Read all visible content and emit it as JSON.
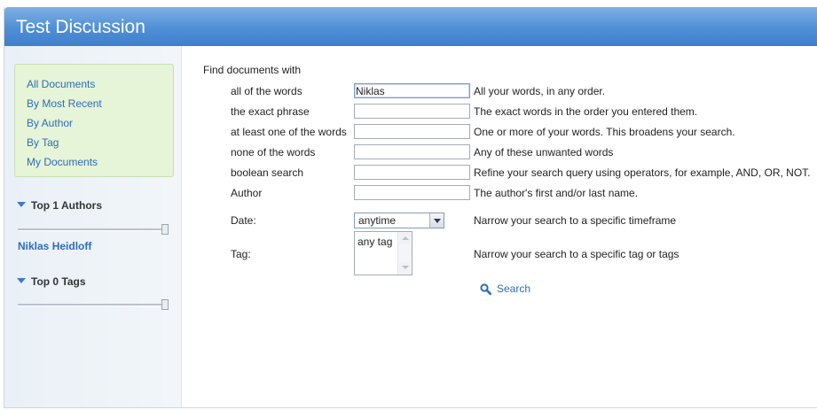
{
  "header": {
    "title": "Test Discussion"
  },
  "sidebar": {
    "nav": [
      "All Documents",
      "By Most Recent",
      "By Author",
      "By Tag",
      "My Documents"
    ],
    "authors_title": "Top 1 Authors",
    "authors": [
      "Niklas Heidloff"
    ],
    "tags_title": "Top 0 Tags"
  },
  "search": {
    "intro": "Find documents with",
    "rows": [
      {
        "label": "all of the words",
        "value": "Niklas",
        "hint": "All your words, in any order."
      },
      {
        "label": "the exact phrase",
        "value": "",
        "hint": "The exact words in the order you entered them."
      },
      {
        "label": "at least one of the words",
        "value": "",
        "hint": "One or more of your words. This broadens your search."
      },
      {
        "label": "none of the words",
        "value": "",
        "hint": "Any of these unwanted words"
      },
      {
        "label": "boolean search",
        "value": "",
        "hint": "Refine your search query using operators, for example, AND, OR, NOT."
      },
      {
        "label": "Author",
        "value": "",
        "hint": "The author's first and/or last name."
      }
    ],
    "date": {
      "label": "Date:",
      "selected": "anytime",
      "hint": "Narrow your search to a specific timeframe"
    },
    "tag": {
      "label": "Tag:",
      "option": "any tag",
      "hint": "Narrow your search to a specific tag or tags"
    },
    "button_label": "Search"
  },
  "colors": {
    "header": "#4f8fd6",
    "link": "#2d6db5",
    "navbox": "#e6f4d7"
  }
}
